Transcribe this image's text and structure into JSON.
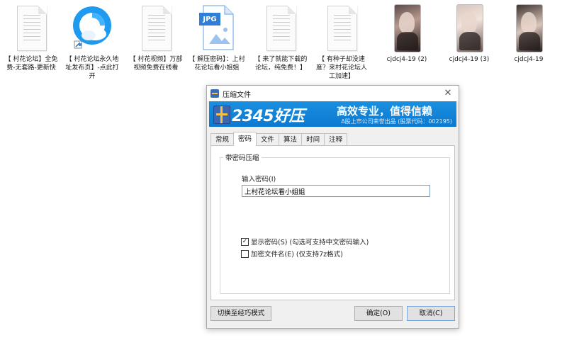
{
  "desktop": {
    "icons": [
      {
        "type": "doc",
        "label": "【 村花论坛】全免费-无套路-更新快"
      },
      {
        "type": "browser",
        "label": "【 村花论坛永久地址发布页】-点此打开"
      },
      {
        "type": "doc",
        "label": "【 村花视频】万部视频免费在线看"
      },
      {
        "type": "jpg",
        "badge": "JPG",
        "label": "【 解压密码】：上村花论坛看小姐姐"
      },
      {
        "type": "doc",
        "label": "【 来了就能下载的论坛，纯免费！】"
      },
      {
        "type": "doc",
        "label": "【 有种子却没速度？来村花论坛人工加速】"
      },
      {
        "type": "thumb",
        "label": "cjdcj4-19 (2)"
      },
      {
        "type": "thumb",
        "label": "cjdcj4-19 (3)"
      },
      {
        "type": "thumb",
        "label": "cjdcj4-19"
      }
    ]
  },
  "dialog": {
    "title": "压缩文件",
    "close_glyph": "✕",
    "banner": {
      "brand": "2345好压",
      "slogan": "高效专业，值得信赖",
      "sub": "A股上市公司荣誉出品 (股票代码：002195)"
    },
    "tabs": [
      {
        "label": "常规",
        "active": false
      },
      {
        "label": "密码",
        "active": true
      },
      {
        "label": "文件",
        "active": false
      },
      {
        "label": "算法",
        "active": false
      },
      {
        "label": "时间",
        "active": false
      },
      {
        "label": "注释",
        "active": false
      }
    ],
    "group_title": "带密码压缩",
    "password_label": "输入密码(I)",
    "password_value": "上村花论坛看小姐姐",
    "show_password": {
      "label": "显示密码(S)  (勾选可支持中文密码输入)",
      "checked": true
    },
    "encrypt_names": {
      "label": "加密文件名(E)  (仅支持7z格式)",
      "checked": false
    },
    "buttons": {
      "switch": "切换至经巧模式",
      "ok": "确定(O)",
      "cancel": "取消(C)"
    },
    "check_glyph": "✓"
  }
}
